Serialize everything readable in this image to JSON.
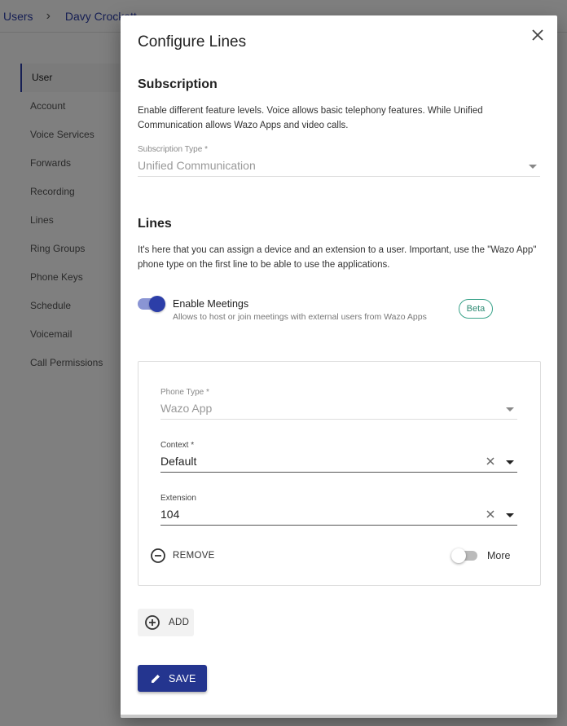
{
  "breadcrumb": {
    "root": "Users",
    "current": "Davy Crockett"
  },
  "sidebar": {
    "items": [
      {
        "label": "User"
      },
      {
        "label": "Account"
      },
      {
        "label": "Voice Services"
      },
      {
        "label": "Forwards"
      },
      {
        "label": "Recording"
      },
      {
        "label": "Lines"
      },
      {
        "label": "Ring Groups"
      },
      {
        "label": "Phone Keys"
      },
      {
        "label": "Schedule"
      },
      {
        "label": "Voicemail"
      },
      {
        "label": "Call Permissions"
      }
    ]
  },
  "dialog": {
    "title": "Configure Lines",
    "subscription": {
      "heading": "Subscription",
      "description": "Enable different feature levels. Voice allows basic telephony features. While Unified Communication allows Wazo Apps and video calls.",
      "type_label": "Subscription Type *",
      "type_value": "Unified Communication"
    },
    "lines": {
      "heading": "Lines",
      "description": "It's here that you can assign a device and an extension to a user. Important, use the \"Wazo App\" phone type on the first line to be able to use the applications.",
      "meetings_title": "Enable Meetings",
      "meetings_sub": "Allows to host or join meetings with external users from Wazo Apps",
      "meetings_badge": "Beta",
      "meetings_enabled": true
    },
    "line": {
      "phone_type_label": "Phone Type *",
      "phone_type_value": "Wazo App",
      "context_label": "Context *",
      "context_value": "Default",
      "extension_label": "Extension",
      "extension_value": "104",
      "remove_label": "REMOVE",
      "more_label": "More",
      "more_enabled": false
    },
    "add_label": "ADD",
    "save_label": "SAVE"
  },
  "colors": {
    "primary": "#24358f",
    "toggle_track": "#8a95d4",
    "beta": "#3aa38a"
  }
}
